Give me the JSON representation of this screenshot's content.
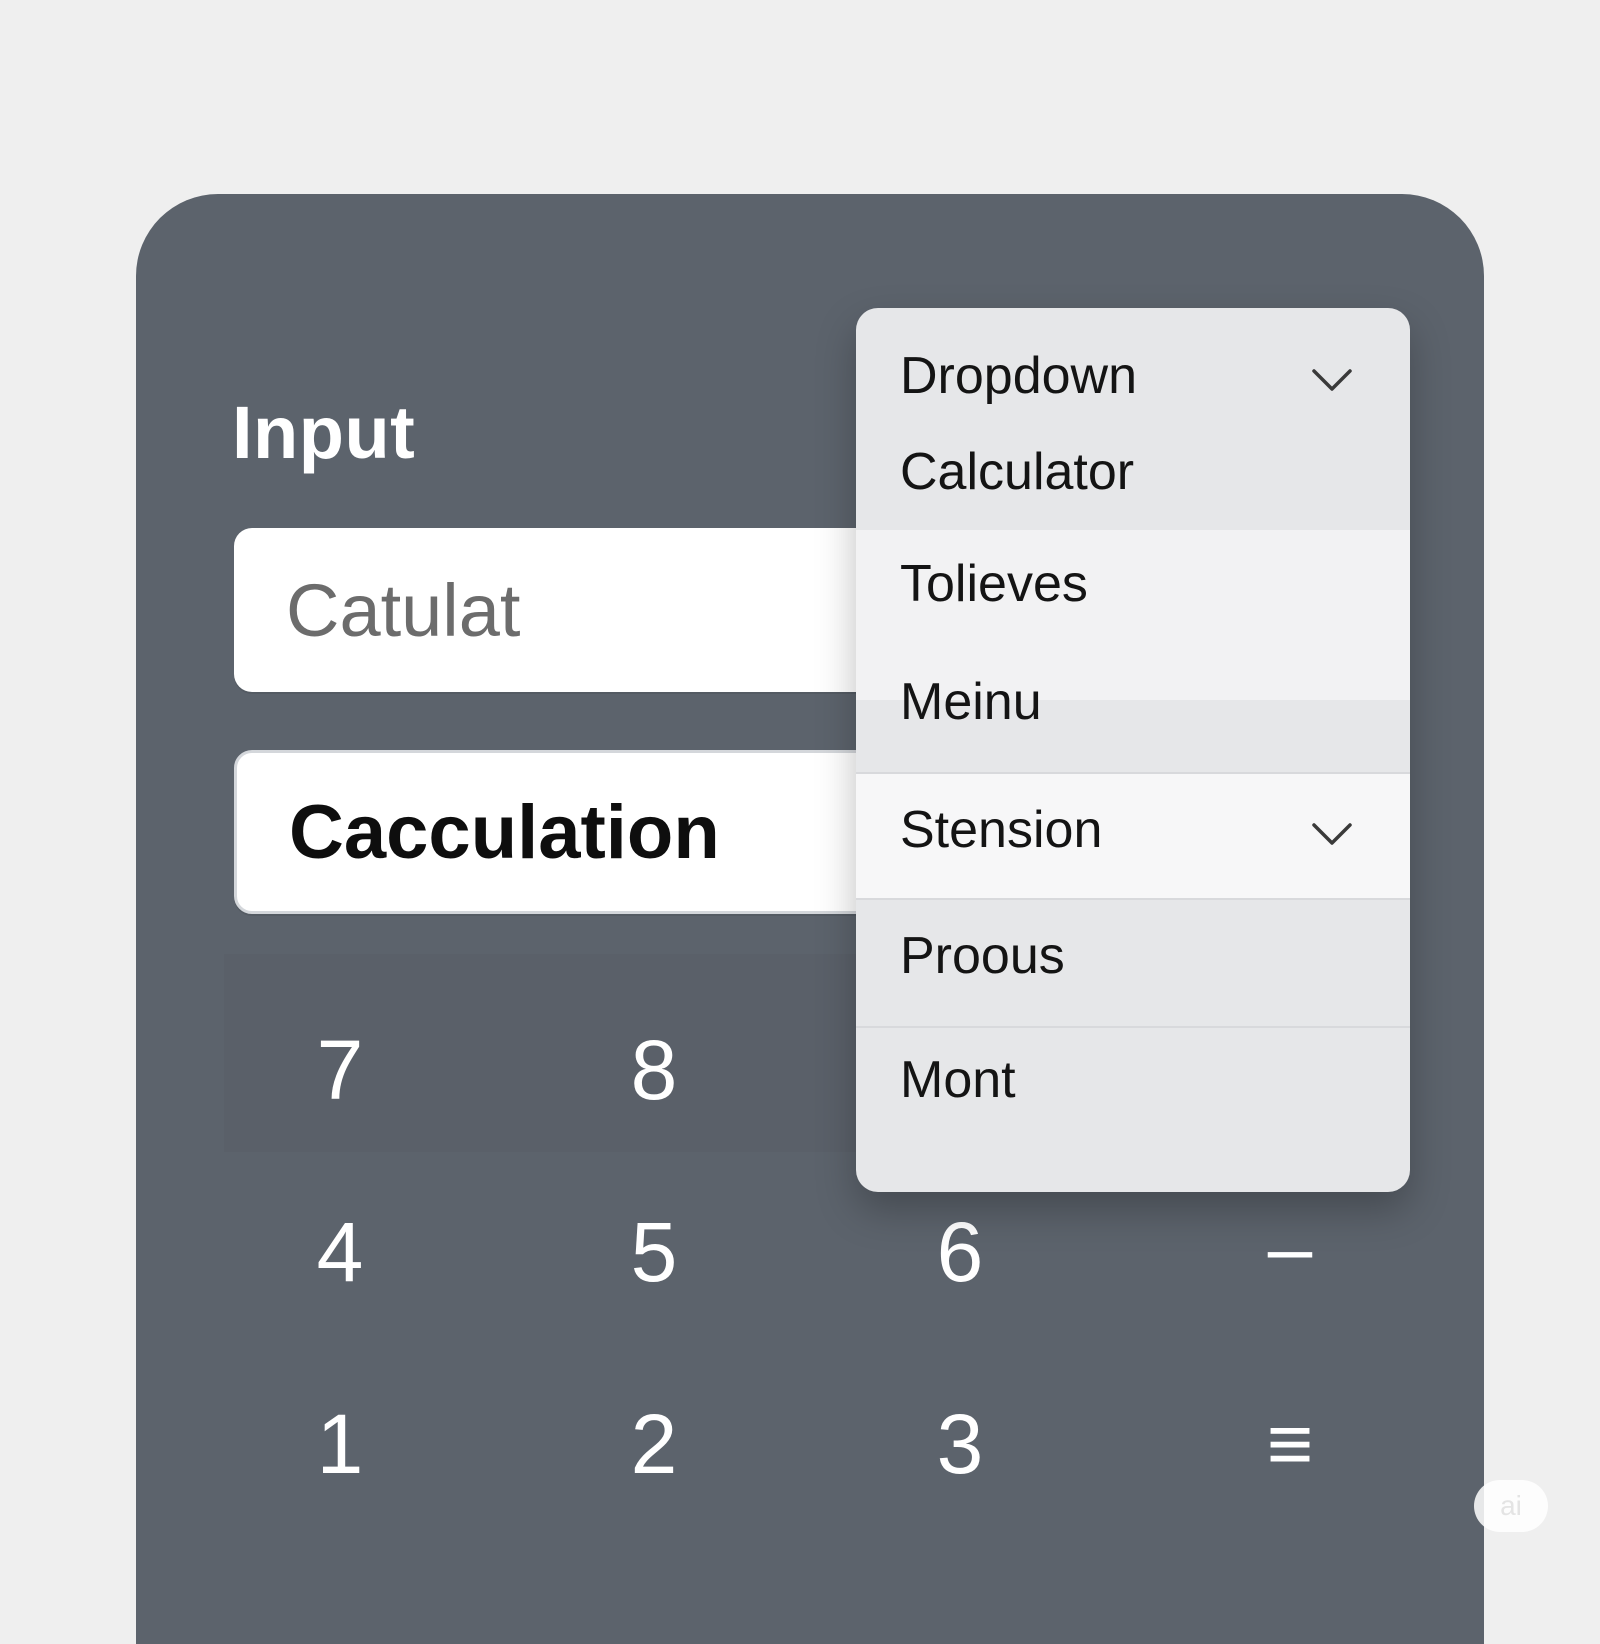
{
  "panel": {
    "input_label": "Input",
    "field_1_value": "Catulat",
    "field_2_value": "Cacculation"
  },
  "keypad": {
    "row1": [
      "7",
      "8"
    ],
    "row2": [
      "4",
      "5",
      "6",
      "–"
    ],
    "row3": [
      "1",
      "2",
      "3",
      "≡"
    ]
  },
  "dropdown": {
    "header": "Dropdown",
    "items": [
      "Calculator",
      "Tolieves",
      "Meinu",
      "Stension",
      "Proous",
      "Mont"
    ],
    "selected_with_chevron": "Stension"
  },
  "badge": {
    "label": "ai"
  },
  "colors": {
    "background": "#efefef",
    "panel": "#5c636c",
    "dropdown": "#e6e7e9",
    "field": "#ffffff"
  },
  "icons": [
    "chevron-down-icon",
    "minus-icon",
    "menu-equals-icon"
  ]
}
